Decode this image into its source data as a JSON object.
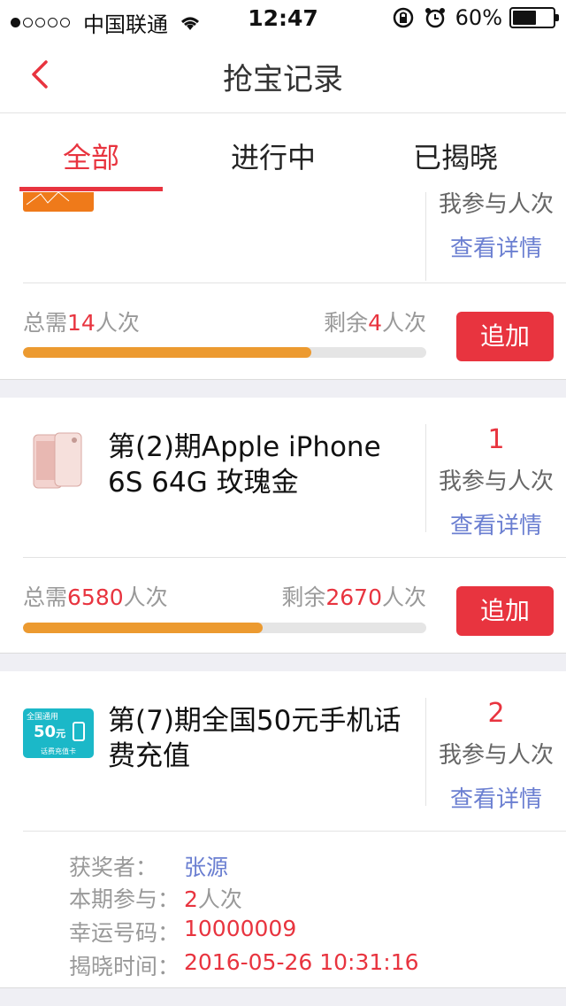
{
  "status_bar": {
    "carrier": "中国联通",
    "time": "12:47",
    "battery": "60%",
    "battery_level": 0.6
  },
  "nav": {
    "title": "抢宝记录"
  },
  "tabs": [
    {
      "label": "全部",
      "active": true
    },
    {
      "label": "进行中",
      "active": false
    },
    {
      "label": "已揭晓",
      "active": false
    }
  ],
  "items": [
    {
      "my_label": "我参与人次",
      "detail_label": "查看详情",
      "total_prefix": "总需",
      "total_value": "14",
      "total_suffix": "人次",
      "remain_prefix": "剩余",
      "remain_value": "4",
      "remain_suffix": "人次",
      "progress": 0.715,
      "add_label": "追加"
    },
    {
      "title": "第(2)期Apple iPhone 6S 64G 玫瑰金",
      "my_count": "1",
      "my_label": "我参与人次",
      "detail_label": "查看详情",
      "total_prefix": "总需",
      "total_value": "6580",
      "total_suffix": "人次",
      "remain_prefix": "剩余",
      "remain_value": "2670",
      "remain_suffix": "人次",
      "progress": 0.594,
      "add_label": "追加"
    },
    {
      "title": "第(7)期全国50元手机话费充值",
      "my_count": "2",
      "my_label": "我参与人次",
      "detail_label": "查看详情",
      "thumb_text": {
        "top": "全国通用",
        "value": "50",
        "unit": "元",
        "bottom": "话费充值卡"
      },
      "winner_label": "获奖者：",
      "winner_name": "张源",
      "participation_label": "本期参与：",
      "participation_value": "2",
      "participation_suffix": "人次",
      "lucky_label": "幸运号码：",
      "lucky_number": "10000009",
      "reveal_label": "揭晓时间：",
      "reveal_time": "2016-05-26 10:31:16"
    }
  ],
  "colors": {
    "accent": "#e8343f",
    "link": "#6b7fd1",
    "progress": "#ec9a30"
  }
}
